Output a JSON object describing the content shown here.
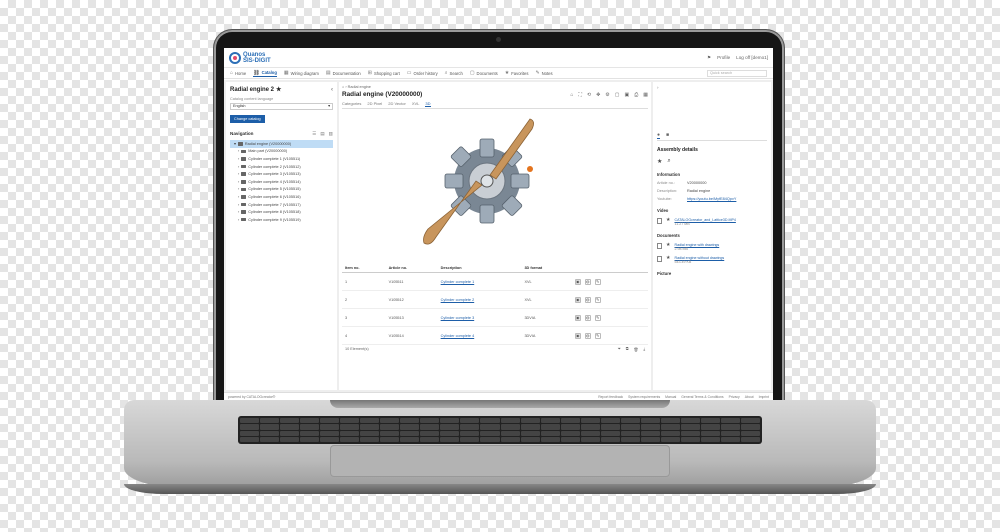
{
  "brand": {
    "name_line1": "Quanos",
    "name_line2": "SIS-DIGIT"
  },
  "header": {
    "profile": "Profile",
    "logoff": "Log off [demo1]"
  },
  "nav": {
    "items": [
      {
        "label": "Home",
        "icon": "home-icon"
      },
      {
        "label": "Catalog",
        "icon": "catalog-icon",
        "active": true
      },
      {
        "label": "Wiring diagram",
        "icon": "wiring-icon"
      },
      {
        "label": "Documentation",
        "icon": "book-icon"
      },
      {
        "label": "Shopping cart",
        "icon": "cart-icon"
      },
      {
        "label": "Order history",
        "icon": "history-icon"
      },
      {
        "label": "Search",
        "icon": "search-icon"
      },
      {
        "label": "Documents",
        "icon": "documents-icon"
      },
      {
        "label": "Favorites",
        "icon": "star-icon"
      },
      {
        "label": "Notes",
        "icon": "notes-icon"
      }
    ],
    "search_placeholder": "Quick search"
  },
  "left": {
    "title": "Radial engine 2",
    "content_language_label": "Catalog content language",
    "language": "English",
    "change_button": "Change catalog",
    "navigation_label": "Navigation",
    "tree": [
      {
        "label": "Radial engine (V20000000)",
        "selected": true,
        "level": 0
      },
      {
        "label": "Main part (V20000000)",
        "level": 1
      },
      {
        "label": "Cylinder complete 1 (V105511)",
        "level": 1
      },
      {
        "label": "Cylinder complete 2 (V105512)",
        "level": 1
      },
      {
        "label": "Cylinder complete 3 (V105513)",
        "level": 1
      },
      {
        "label": "Cylinder complete 4 (V105514)",
        "level": 1
      },
      {
        "label": "Cylinder complete 5 (V105515)",
        "level": 1
      },
      {
        "label": "Cylinder complete 6 (V105516)",
        "level": 1
      },
      {
        "label": "Cylinder complete 7 (V105517)",
        "level": 1
      },
      {
        "label": "Cylinder complete 8 (V105518)",
        "level": 1
      },
      {
        "label": "Cylinder complete 9 (V105519)",
        "level": 1
      }
    ]
  },
  "center": {
    "breadcrumb": "Radial engine",
    "title": "Radial engine (V20000000)",
    "tabs": [
      "Categories",
      "2D Pixel",
      "2D Vector",
      "XVL",
      "3D"
    ],
    "active_tab": "3D",
    "columns": [
      "Item no.",
      "Article no.",
      "Description",
      "3D format"
    ],
    "rows": [
      {
        "item": "1",
        "article": "V105511",
        "description": "Cylinder complete 1",
        "format": "XVL"
      },
      {
        "item": "2",
        "article": "V105512",
        "description": "Cylinder complete 2",
        "format": "XVL"
      },
      {
        "item": "3",
        "article": "V105513",
        "description": "Cylinder complete 3",
        "format": "3DVIA"
      },
      {
        "item": "4",
        "article": "V105514",
        "description": "Cylinder complete 4",
        "format": "3DVIA"
      }
    ],
    "element_count": "10 Element(s)"
  },
  "right": {
    "title": "Assembly details",
    "information_label": "Information",
    "info": [
      {
        "key": "Article no.:",
        "value": "V20000000"
      },
      {
        "key": "Description:",
        "value": "Radial engine"
      },
      {
        "key": "Youtube:",
        "value": "https://youtu.be/MyfE84QpvY",
        "link": true
      }
    ],
    "video_label": "Video",
    "video": {
      "name": "CATALOGcreator_and_Lattice3D.MP4",
      "size": "11.27 MB"
    },
    "documents_label": "Documents",
    "documents": [
      {
        "name": "Radial engine with drawings",
        "size": "2.98 MB"
      },
      {
        "name": "Radial engine without drawings",
        "size": "543.49 KB"
      }
    ],
    "picture_label": "Picture"
  },
  "footer": {
    "powered": "powered by CATALOGcreator®",
    "links": [
      "Report feedback",
      "System requirements",
      "Manual",
      "General Terms & Conditions",
      "Privacy",
      "About",
      "Imprint"
    ]
  }
}
